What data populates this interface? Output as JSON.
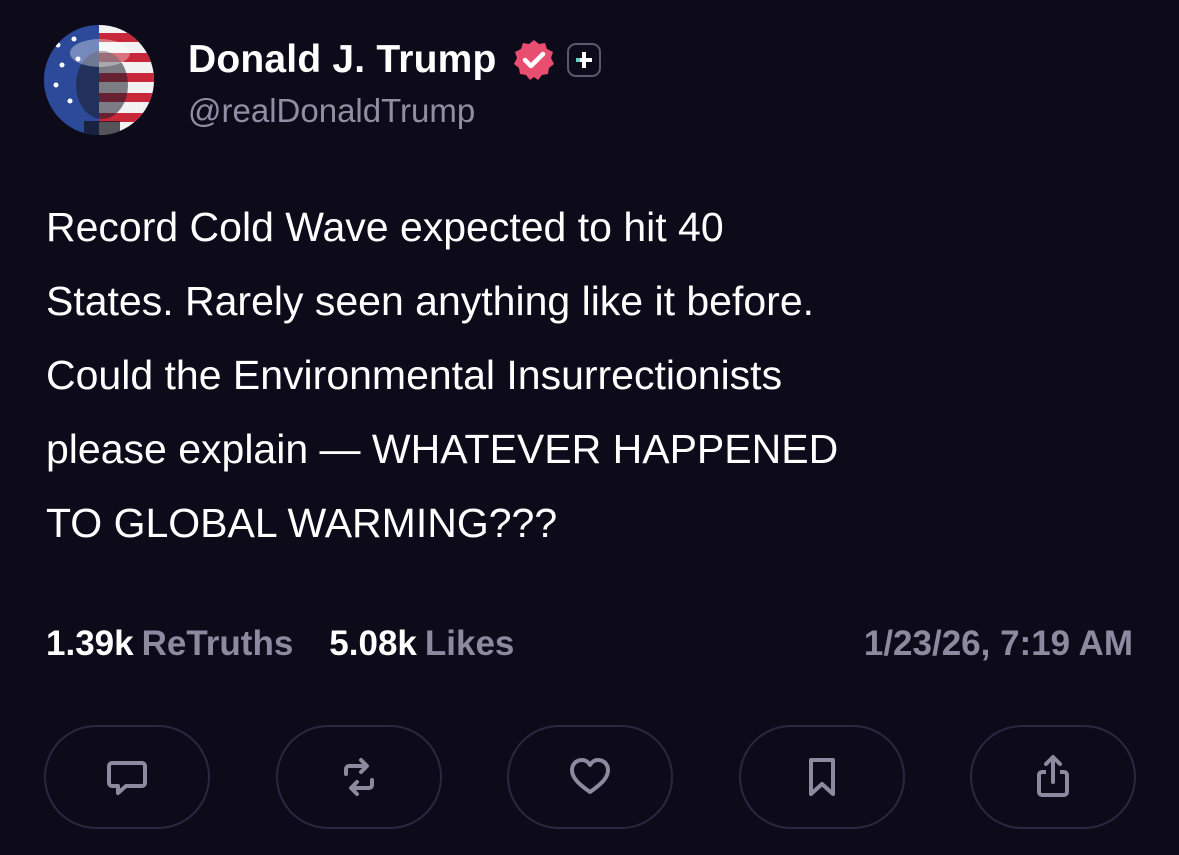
{
  "author": {
    "display_name": "Donald J. Trump",
    "handle": "@realDonaldTrump",
    "verified_icon": "verified-check-icon",
    "plus_icon": "plus-icon",
    "verified_color": "#e84e6f"
  },
  "post": {
    "text": "Record Cold Wave expected to hit 40\nStates. Rarely seen anything like it before.\nCould the Environmental Insurrectionists\nplease explain — WHATEVER HAPPENED\nTO GLOBAL WARMING???"
  },
  "stats": {
    "retruths_count": "1.39k",
    "retruths_label": "ReTruths",
    "likes_count": "5.08k",
    "likes_label": "Likes",
    "timestamp": "1/23/26, 7:19 AM"
  },
  "actions": [
    {
      "icon": "reply-icon"
    },
    {
      "icon": "retruth-icon"
    },
    {
      "icon": "like-icon"
    },
    {
      "icon": "bookmark-icon"
    },
    {
      "icon": "share-icon"
    }
  ],
  "colors": {
    "background": "#0d0b1a",
    "muted_text": "#8d8aa0",
    "icon": "#8d8aa0"
  }
}
